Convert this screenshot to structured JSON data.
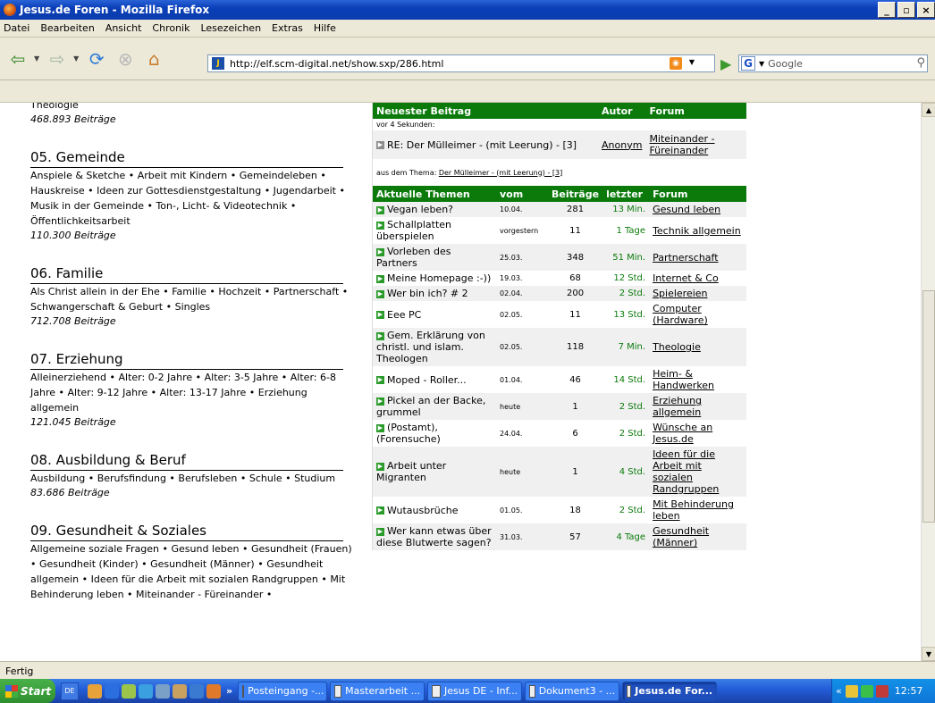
{
  "window": {
    "title": "Jesus.de Foren - Mozilla Firefox"
  },
  "menu": [
    "Datei",
    "Bearbeiten",
    "Ansicht",
    "Chronik",
    "Lesezeichen",
    "Extras",
    "Hilfe"
  ],
  "url": "http://elf.scm-digital.net/show.sxp/286.html",
  "search": {
    "placeholder": "Google"
  },
  "left": {
    "first": {
      "name": "Theologie",
      "count": "468.893 Beiträge"
    },
    "cats": [
      {
        "title": "05. Gemeinde",
        "subs": "Anspiele & Sketche • Arbeit mit Kindern • Gemeindeleben • Hauskreise • Ideen zur Gottesdienstgestaltung • Jugendarbeit • Musik in der Gemeinde • Ton-, Licht- & Videotechnik • Öffentlichkeitsarbeit",
        "count": "110.300 Beiträge"
      },
      {
        "title": "06. Familie",
        "subs": "Als Christ allein in der Ehe • Familie • Hochzeit • Partnerschaft • Schwangerschaft & Geburt • Singles",
        "count": "712.708 Beiträge"
      },
      {
        "title": "07. Erziehung",
        "subs": "Alleinerziehend • Alter: 0-2 Jahre • Alter: 3-5 Jahre • Alter: 6-8 Jahre • Alter: 9-12 Jahre • Alter: 13-17 Jahre • Erziehung allgemein",
        "count": "121.045 Beiträge"
      },
      {
        "title": "08. Ausbildung & Beruf",
        "subs": "Ausbildung • Berufsfindung • Berufsleben • Schule • Studium",
        "count": "83.686 Beiträge"
      },
      {
        "title": "09. Gesundheit & Soziales",
        "subs": "Allgemeine soziale Fragen • Gesund leben • Gesundheit (Frauen) • Gesundheit (Kinder) • Gesundheit (Männer) • Gesundheit allgemein • Ideen für die Arbeit mit sozialen Randgruppen • Mit Behinderung leben • Miteinander - Füreinander •",
        "count": ""
      }
    ]
  },
  "newest": {
    "headers": {
      "post": "Neuester Beitrag",
      "author": "Autor",
      "forum": "Forum"
    },
    "time": "vor 4 Sekunden:",
    "title": "RE: Der Mülleimer - (mit Leerung) - [3]",
    "author": "Anonym",
    "forum": "Miteinander - Füreinander",
    "thread_prefix": "aus dem Thema:",
    "thread": "Der Mülleimer - (mit Leerung) - [3]"
  },
  "topics": {
    "headers": {
      "topic": "Aktuelle Themen",
      "from": "vom",
      "posts": "Beiträge",
      "last": "letzter",
      "forum": "Forum"
    },
    "rows": [
      {
        "title": "Vegan leben?",
        "from": "10.04.",
        "posts": "281",
        "last": "13 Min.",
        "forum": "Gesund leben"
      },
      {
        "title": "Schallplatten überspielen",
        "from": "vorgestern",
        "posts": "11",
        "last": "1 Tage",
        "forum": "Technik allgemein"
      },
      {
        "title": "Vorleben des Partners",
        "from": "25.03.",
        "posts": "348",
        "last": "51 Min.",
        "forum": "Partnerschaft"
      },
      {
        "title": "Meine Homepage :-))",
        "from": "19.03.",
        "posts": "68",
        "last": "12 Std.",
        "forum": "Internet & Co"
      },
      {
        "title": "Wer bin ich? # 2",
        "from": "02.04.",
        "posts": "200",
        "last": "2 Std.",
        "forum": "Spielereien"
      },
      {
        "title": "Eee PC",
        "from": "02.05.",
        "posts": "11",
        "last": "13 Std.",
        "forum": "Computer (Hardware)"
      },
      {
        "title": "Gem. Erklärung von christl. und islam. Theologen",
        "from": "02.05.",
        "posts": "118",
        "last": "7 Min.",
        "forum": "Theologie"
      },
      {
        "title": "Moped - Roller...",
        "from": "01.04.",
        "posts": "46",
        "last": "14 Std.",
        "forum": "Heim- & Handwerken"
      },
      {
        "title": "Pickel an der Backe, grummel",
        "from": "heute",
        "posts": "1",
        "last": "2 Std.",
        "forum": "Erziehung allgemein"
      },
      {
        "title": "(Postamt), (Forensuche)",
        "from": "24.04.",
        "posts": "6",
        "last": "2 Std.",
        "forum": "Wünsche an Jesus.de"
      },
      {
        "title": "Arbeit unter Migranten",
        "from": "heute",
        "posts": "1",
        "last": "4 Std.",
        "forum": "Ideen für die Arbeit mit sozialen Randgruppen"
      },
      {
        "title": "Wutausbrüche",
        "from": "01.05.",
        "posts": "18",
        "last": "2 Std.",
        "forum": "Mit Behinderung leben"
      },
      {
        "title": "Wer kann etwas über diese Blutwerte sagen?",
        "from": "31.03.",
        "posts": "57",
        "last": "4 Tage",
        "forum": "Gesundheit (Männer)"
      }
    ]
  },
  "status": "Fertig",
  "taskbar": {
    "start": "Start",
    "lang": "DE",
    "items": [
      "Posteingang -...",
      "Masterarbeit ...",
      "Jesus DE - Inf...",
      "Dokument3 - ...",
      "Jesus.de For..."
    ],
    "clock": "12:57"
  }
}
